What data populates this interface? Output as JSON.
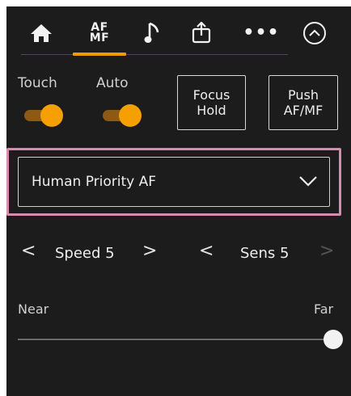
{
  "tabs": [
    {
      "name": "home",
      "icon": "home-icon"
    },
    {
      "name": "af-mf",
      "line1": "AF",
      "line2": "MF",
      "active": true
    },
    {
      "name": "audio",
      "icon": "music-note-icon"
    },
    {
      "name": "assign",
      "icon": "assign-icon"
    },
    {
      "name": "more",
      "label": "•••"
    },
    {
      "name": "collapse",
      "icon": "chevron-up-circle-icon"
    }
  ],
  "toggles": {
    "touch": {
      "label": "Touch",
      "on": true
    },
    "auto": {
      "label": "Auto",
      "on": true
    }
  },
  "buttons": {
    "focus_hold": {
      "line1": "Focus",
      "line2": "Hold"
    },
    "push_af_mf": {
      "line1": "Push",
      "line2": "AF/MF"
    }
  },
  "af_mode": {
    "selected": "Human Priority AF"
  },
  "speed": {
    "label": "Speed 5",
    "prev": "<",
    "next": ">"
  },
  "sens": {
    "label": "Sens 5",
    "prev": "<",
    "next": ">"
  },
  "focus_slider": {
    "min_label": "Near",
    "max_label": "Far",
    "value": 1.0
  },
  "colors": {
    "accent": "#f39800",
    "highlight": "#d78cae",
    "background": "#1c1c1c"
  }
}
